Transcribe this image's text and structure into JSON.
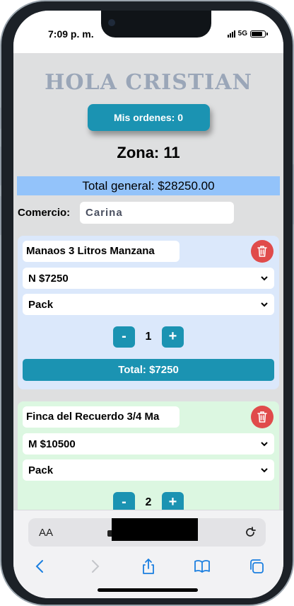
{
  "status": {
    "time": "7:09 p. m.",
    "network": "5G"
  },
  "app": {
    "greeting": "HOLA CRISTIAN",
    "orders_label": "Mis ordenes: 0",
    "zona": "Zona: 11",
    "total_general": "Total general: $28250.00",
    "comercio_label": "Comercio:",
    "comercio_value": "Carina",
    "cards": [
      {
        "product": "Manaos 3 Litros Manzana",
        "price_option": "N $7250",
        "unit_option": "Pack",
        "quantity": "1",
        "minus": "-",
        "plus": "+",
        "total": "Total: $7250"
      },
      {
        "product": "Finca del Recuerdo 3/4 Ma",
        "price_option": "M $10500",
        "unit_option": "Pack",
        "quantity": "2",
        "minus": "-",
        "plus": "+"
      }
    ]
  },
  "browser": {
    "text_size_label": "AA"
  },
  "icons": {
    "trash": "trash-icon",
    "chevron": "chevron-down-icon",
    "reload": "reload-icon",
    "back": "back-icon",
    "forward": "forward-icon",
    "share": "share-icon",
    "bookmarks": "bookmarks-icon",
    "tabs": "tabs-icon"
  },
  "colors": {
    "accent": "#1b93b2",
    "total_bar": "#93c3fa",
    "card_blue": "#dbe8fb",
    "card_green": "#dcf7e1",
    "trash": "#e04b4b"
  }
}
